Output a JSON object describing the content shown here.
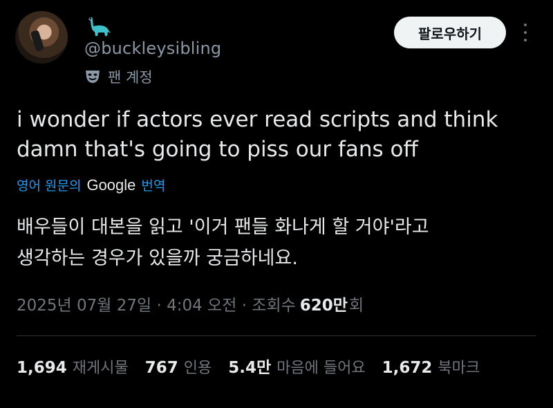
{
  "user": {
    "handle": "@buckleysibling",
    "badge_label": "팬 계정",
    "badge_icon": "theater-mask-icon",
    "name_emoji": "sauropod-emoji"
  },
  "actions": {
    "follow_label": "팔로우하기",
    "more_icon": "more-vertical-icon"
  },
  "tweet": {
    "text_line1": "i wonder if actors ever read scripts and think",
    "text_line2": "damn that's going to piss our fans off"
  },
  "translation": {
    "prefix": "영어 원문의",
    "provider": "Google",
    "suffix": "번역",
    "text_line1": "배우들이 대본을 읽고 '이거 팬들 화나게 할 거야'라고",
    "text_line2": "생각하는 경우가 있을까 궁금하네요."
  },
  "meta": {
    "timestamp": "2025년 07월 27일 · 4:04 오전 · 조회수",
    "views": "620만",
    "views_suffix": "회"
  },
  "stats": [
    {
      "num": "1,694",
      "label": "재게시물"
    },
    {
      "num": "767",
      "label": "인용"
    },
    {
      "num": "5.4만",
      "label": "마음에 들어요"
    },
    {
      "num": "1,672",
      "label": "북마크"
    }
  ],
  "colors": {
    "background": "#000000",
    "text": "#e7e9ea",
    "muted": "#71767b",
    "link": "#1d9bf0",
    "button_bg": "#eff3f4",
    "emoji_teal": "#3fc1c9"
  }
}
